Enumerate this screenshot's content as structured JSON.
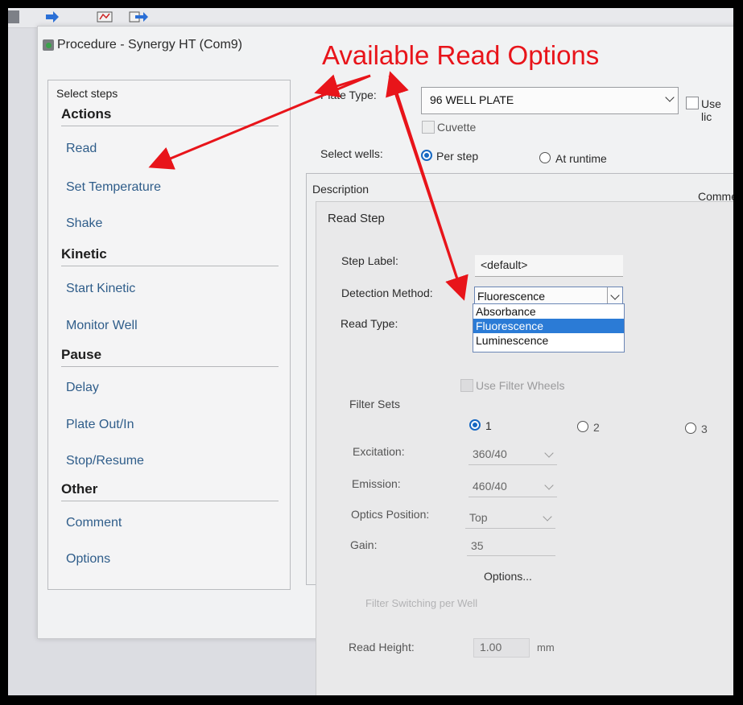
{
  "window": {
    "title": "Procedure - Synergy HT (Com9)"
  },
  "annotation": {
    "text": "Available Read Options",
    "color": "#e8141a"
  },
  "steps_panel": {
    "title": "Select steps",
    "sections": [
      {
        "heading": "Actions",
        "items": [
          "Read",
          "Set Temperature",
          "Shake"
        ]
      },
      {
        "heading": "Kinetic",
        "items": [
          "Start Kinetic",
          "Monitor Well"
        ]
      },
      {
        "heading": "Pause",
        "items": [
          "Delay",
          "Plate Out/In",
          "Stop/Resume"
        ]
      },
      {
        "heading": "Other",
        "items": [
          "Comment",
          "Options"
        ]
      }
    ]
  },
  "plate": {
    "label": "Plate Type:",
    "value": "96 WELL PLATE",
    "use_lid_label": "Use lic",
    "cuvette_label": "Cuvette"
  },
  "select_wells": {
    "label": "Select wells:",
    "per_step": "Per step",
    "at_runtime": "At runtime",
    "selected": "Per step"
  },
  "columns": {
    "description": "Description",
    "comment": "Comme"
  },
  "read_step": {
    "heading": "Read Step",
    "step_label": {
      "label": "Step Label:",
      "value": "<default>"
    },
    "detection": {
      "label": "Detection Method:",
      "value": "Fluorescence",
      "options": [
        "Absorbance",
        "Fluorescence",
        "Luminescence"
      ]
    },
    "read_type_label": "Read Type:",
    "use_filter_wheels": "Use Filter Wheels",
    "filter_sets": {
      "label": "Filter Sets",
      "options": [
        "1",
        "2",
        "3"
      ],
      "selected": "1"
    },
    "excitation": {
      "label": "Excitation:",
      "value": "360/40"
    },
    "emission": {
      "label": "Emission:",
      "value": "460/40"
    },
    "optics": {
      "label": "Optics Position:",
      "value": "Top"
    },
    "gain": {
      "label": "Gain:",
      "value": "35"
    },
    "options_button": "Options...",
    "filter_switching": "Filter Switching per Well",
    "read_height": {
      "label": "Read Height:",
      "value": "1.00",
      "unit": "mm"
    }
  }
}
